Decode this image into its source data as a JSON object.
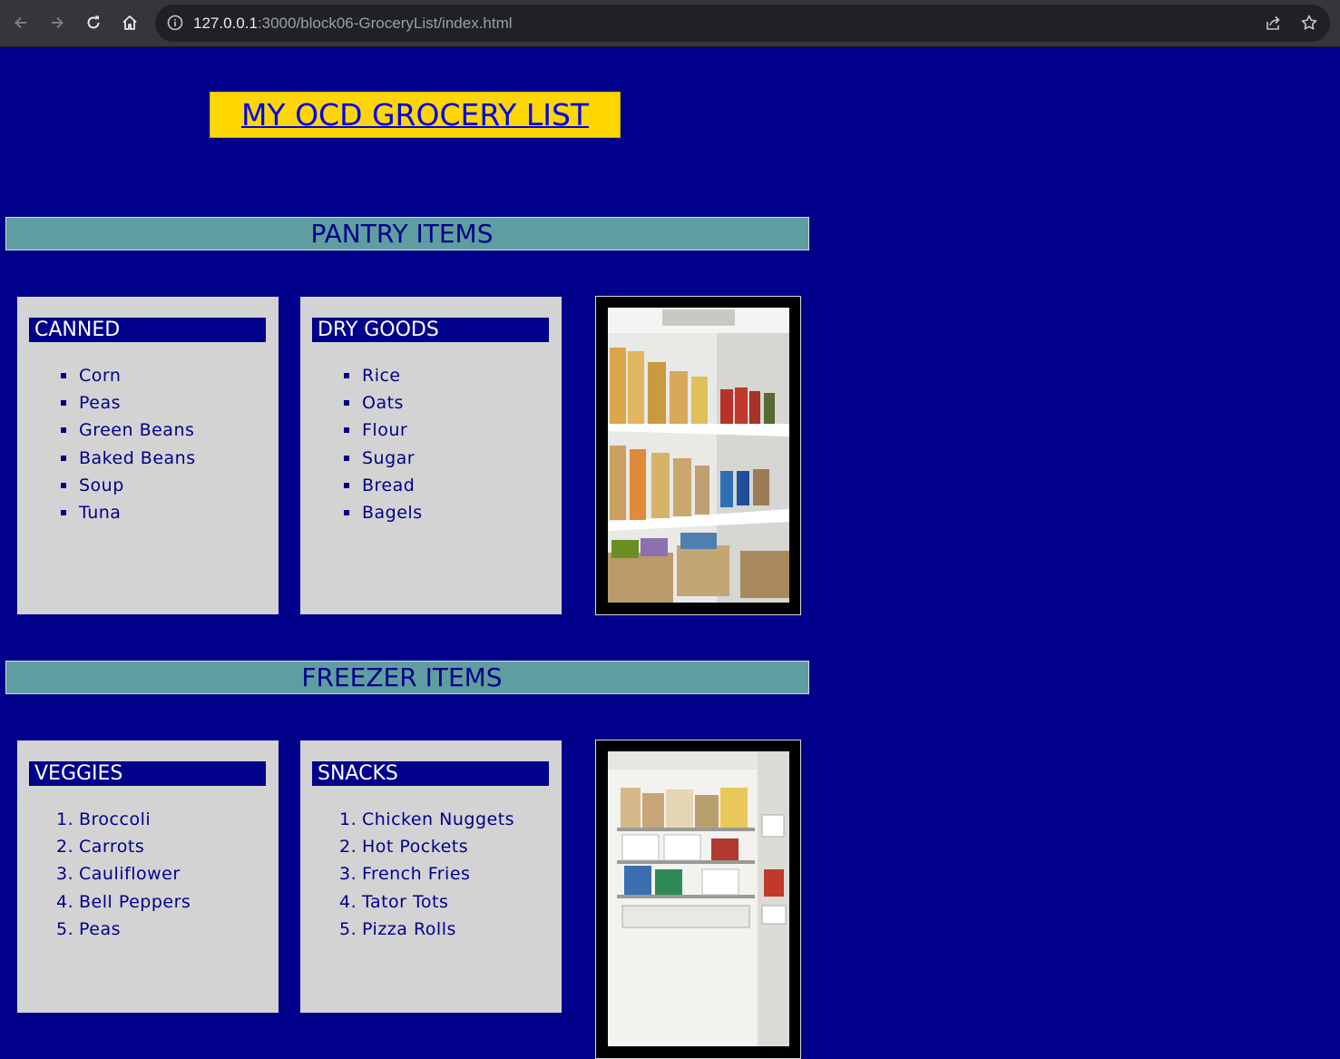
{
  "browser": {
    "url_host": "127.0.0.1",
    "url_path": ":3000/block06-GroceryList/index.html",
    "icons": [
      "back-arrow-icon",
      "forward-arrow-icon",
      "reload-icon",
      "home-icon",
      "site-info-icon",
      "share-icon",
      "bookmark-star-icon"
    ]
  },
  "page": {
    "title": "MY OCD GROCERY LIST",
    "colors": {
      "background": "#00008b",
      "title_bg": "#ffd700",
      "section_bg": "#5f9ea0",
      "card_bg": "#d3d3d3",
      "link": "#0000ee"
    },
    "sections": [
      {
        "title": "PANTRY ITEMS",
        "cards": [
          {
            "heading": "CANNED",
            "list_type": "bullet",
            "items": [
              "Corn",
              "Peas",
              "Green Beans",
              "Baked Beans",
              "Soup",
              "Tuna"
            ]
          },
          {
            "heading": "DRY GOODS",
            "list_type": "bullet",
            "items": [
              "Rice",
              "Oats",
              "Flour",
              "Sugar",
              "Bread",
              "Bagels"
            ]
          }
        ],
        "photo": "pantry-shelves-photo"
      },
      {
        "title": "FREEZER ITEMS",
        "cards": [
          {
            "heading": "VEGGIES",
            "list_type": "numbered",
            "items": [
              "Broccoli",
              "Carrots",
              "Cauliflower",
              "Bell Peppers",
              "Peas"
            ]
          },
          {
            "heading": "SNACKS",
            "list_type": "numbered",
            "items": [
              "Chicken Nuggets",
              "Hot Pockets",
              "French Fries",
              "Tator Tots",
              "Pizza Rolls"
            ]
          }
        ],
        "photo": "freezer-photo"
      }
    ]
  }
}
